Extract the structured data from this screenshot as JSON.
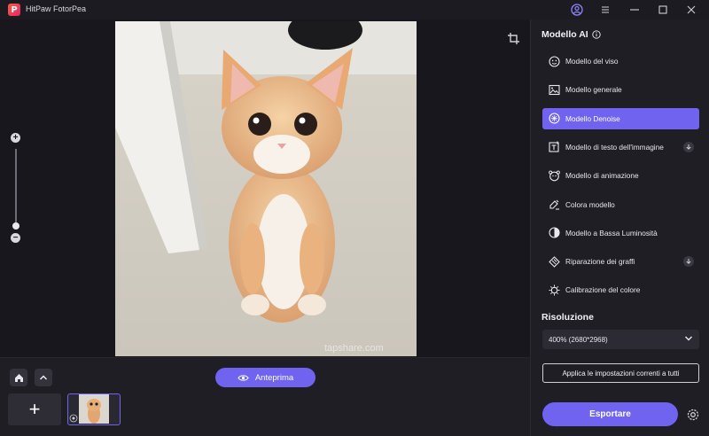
{
  "app": {
    "title": "HitPaw FotorPea",
    "logo_letter": "P"
  },
  "window_controls": [
    "account-icon",
    "menu-icon",
    "minimize-icon",
    "maximize-icon",
    "close-icon"
  ],
  "canvas": {
    "watermark": "tapshare.com"
  },
  "panel": {
    "model_header": "Modello AI",
    "models": [
      {
        "label": "Modello del viso",
        "icon": "face-icon",
        "active": false,
        "download": false
      },
      {
        "label": "Modello generale",
        "icon": "image-icon",
        "active": false,
        "download": false
      },
      {
        "label": "Modello Denoise",
        "icon": "denoise-icon",
        "active": true,
        "download": false
      },
      {
        "label": "Modello di testo dell'immagine",
        "icon": "text-image-icon",
        "active": false,
        "download": true
      },
      {
        "label": "Modello di animazione",
        "icon": "animation-icon",
        "active": false,
        "download": false
      },
      {
        "label": "Colora modello",
        "icon": "colorize-icon",
        "active": false,
        "download": false
      },
      {
        "label": "Modello a Bassa Luminosità",
        "icon": "low-light-icon",
        "active": false,
        "download": false
      },
      {
        "label": "Riparazione dei graffi",
        "icon": "scratch-repair-icon",
        "active": false,
        "download": true
      },
      {
        "label": "Calibrazione del colore",
        "icon": "color-calibration-icon",
        "active": false,
        "download": false
      }
    ],
    "resolution_header": "Risoluzione",
    "resolution_value": "400% (2680*2968)",
    "apply_label": "Applica le impostazioni correnti a tutti",
    "export_label": "Esportare"
  },
  "bottom": {
    "preview_label": "Anteprima",
    "add_symbol": "+"
  },
  "colors": {
    "accent": "#6f63ef",
    "background": "#1c1b22",
    "panel": "#1f1e25"
  }
}
